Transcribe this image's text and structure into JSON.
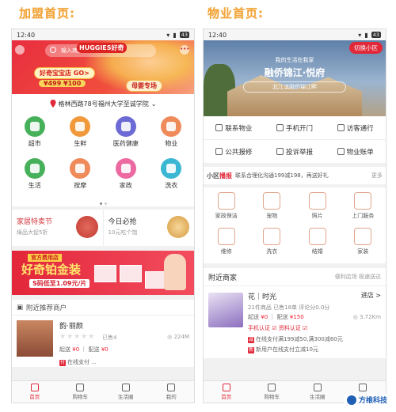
{
  "left_title": "加盟首页:",
  "right_title": "物业首页:",
  "status": {
    "time": "12:40",
    "battery": "43"
  },
  "left": {
    "banner": {
      "brand": "HUGGIES好奇",
      "search_placeholder": "输入商品、店铺",
      "cta": "好奇宝宝店 GO>",
      "price": "¥499 ¥100",
      "promo": "母婴专场"
    },
    "location": "格林西路78号福州大学至诚学院",
    "categories": [
      {
        "label": "超市",
        "color": "#46b15a"
      },
      {
        "label": "生鲜",
        "color": "#f19a3b"
      },
      {
        "label": "医药健康",
        "color": "#6c6ad4"
      },
      {
        "label": "物业",
        "color": "#ef8a5a"
      },
      {
        "label": "生活",
        "color": "#46b15a"
      },
      {
        "label": "按摩",
        "color": "#ef8a5a"
      },
      {
        "label": "家政",
        "color": "#ec6aa1"
      },
      {
        "label": "洗衣",
        "color": "#3cb7d3"
      }
    ],
    "promo1": {
      "title": "家居特卖节",
      "sub": "綠品大促5折"
    },
    "promo2": {
      "title": "今日必抢",
      "sub": "10元吃个饱"
    },
    "ad": {
      "flag": "官方费用店",
      "big": "好奇铂金装",
      "price": "S码低至1.09元/片"
    },
    "nearby_title": "附近推荐商户",
    "shop": {
      "name": "韵·丽颜",
      "stars": "★★★★★",
      "sold": "已售4",
      "distance": "224M",
      "fee_label": "起送",
      "fee": "¥0",
      "delivery_label": "配送",
      "delivery": "¥0",
      "tag": "在线支付 ..."
    },
    "tabs": [
      "首页",
      "购物车",
      "生活圈",
      "我的"
    ]
  },
  "right": {
    "banner": {
      "switch": "切换小区",
      "sub": "我的生活在我家",
      "big": "融侨锦江·悦府",
      "addr": "北江滨融侨锦江畔"
    },
    "services": [
      "联系物业",
      "手机开门",
      "访客通行",
      "公共报修",
      "投诉举报",
      "物业账单"
    ],
    "notice": {
      "label_a": "小区",
      "label_b": "播报",
      "text": "联系合理化沟通199减198，再送好礼",
      "more": "更多"
    },
    "grid": [
      "家政保洁",
      "宠物",
      "照片",
      "上门服务",
      "维修",
      "洗衣",
      "结婚",
      "家装"
    ],
    "merchants_title": "附近商家",
    "merchants_right": "便利店场 极速送达",
    "shop": {
      "name": "花｜时光",
      "store": "进店 >",
      "info": "21件商品  已售18单  评论分0.0分",
      "fee_label": "起送",
      "fee": "¥0",
      "delivery_label": "配送",
      "delivery": "¥150",
      "distance": "3.72Km",
      "cert": "手机认证  ☑  资料认证  ☑",
      "promo1": "在线支付满199减50,满300减60元",
      "promo2": "新用户在线支付立减10元"
    },
    "tabs": [
      "首页",
      "购物车",
      "生活圈",
      "我的"
    ]
  },
  "watermark": "方维科技"
}
